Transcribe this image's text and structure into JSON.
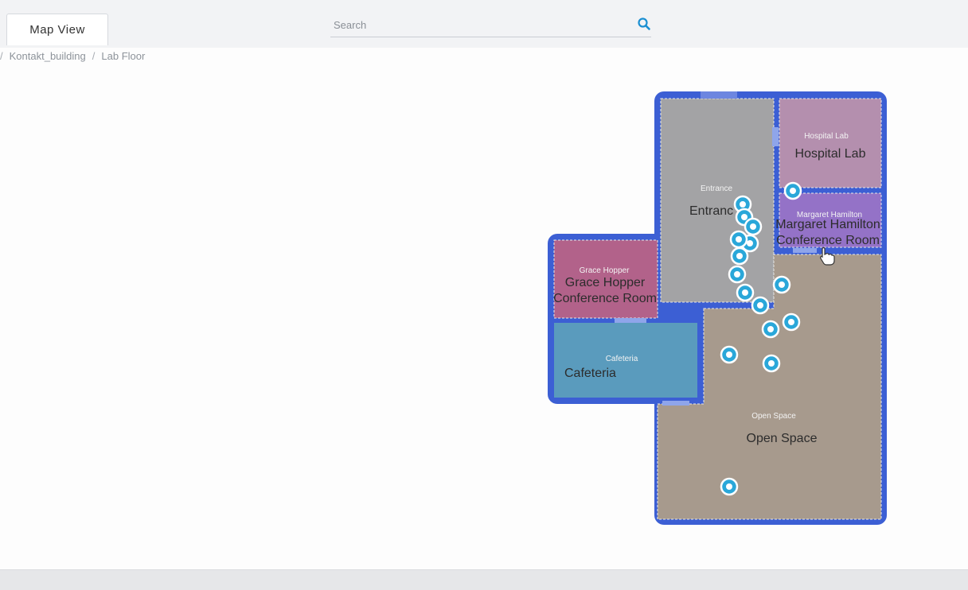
{
  "header": {
    "tab_label": "Map View",
    "search_placeholder": "Search"
  },
  "breadcrumb": {
    "items": [
      "Kontakt_building",
      "Lab Floor"
    ]
  },
  "floorplan": {
    "zones": [
      {
        "id": "entrance",
        "small_label": "Entrance",
        "label": "Entranc",
        "color": "#a3a3a5"
      },
      {
        "id": "hospital-lab",
        "small_label": "Hospital Lab",
        "label": "Hospital Lab",
        "color": "#b48fae"
      },
      {
        "id": "margaret-hamilton",
        "small_label": "Margaret Hamilton",
        "label_line1": "Margaret Hamilton",
        "label_line2": "Conference Room",
        "color": "#9472c7"
      },
      {
        "id": "grace-hopper",
        "small_label": "Grace Hopper",
        "label_line1": "Grace Hopper",
        "label_line2": "Conference Room",
        "color": "#b2628a"
      },
      {
        "id": "cafeteria",
        "small_label": "Cafeteria",
        "label": "Cafeteria",
        "color": "#5a9bbd"
      },
      {
        "id": "open-space",
        "small_label": "Open Space",
        "label": "Open Space",
        "color": "#a79a8d"
      }
    ],
    "wall_color": "#3c5fd4",
    "marker_color": "#2aa7d9"
  }
}
